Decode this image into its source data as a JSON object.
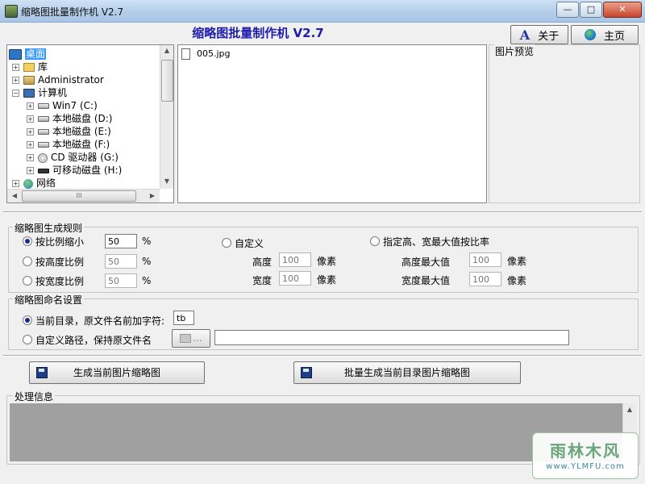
{
  "window": {
    "title": "缩略图批量制作机 V2.7",
    "min_glyph": "—",
    "max_glyph": "□",
    "close_glyph": "✕"
  },
  "header": {
    "heading": "缩略图批量制作机  V2.7",
    "about_label": "关于",
    "home_label": "主页"
  },
  "tree": {
    "items": [
      {
        "label": "桌面",
        "icon": "desktop-icon",
        "selected": true
      },
      {
        "label": "库",
        "icon": "library-icon"
      },
      {
        "label": "Administrator",
        "icon": "user-icon"
      },
      {
        "label": "计算机",
        "icon": "computer-icon"
      },
      {
        "label": "Win7 (C:)",
        "icon": "drive-icon"
      },
      {
        "label": "本地磁盘 (D:)",
        "icon": "drive-icon"
      },
      {
        "label": "本地磁盘 (E:)",
        "icon": "drive-icon"
      },
      {
        "label": "本地磁盘 (F:)",
        "icon": "drive-icon"
      },
      {
        "label": "CD 驱动器 (G:)",
        "icon": "cd-drive-icon"
      },
      {
        "label": "可移动磁盘 (H:)",
        "icon": "removable-drive-icon"
      },
      {
        "label": "网络",
        "icon": "network-icon"
      }
    ],
    "hscroll_grip": "III"
  },
  "files": {
    "items": [
      "005.jpg"
    ]
  },
  "preview": {
    "label": "图片预览"
  },
  "rules": {
    "group_label": "缩略图生成规则",
    "by_ratio_label": "按比例缩小",
    "by_ratio_value": "50",
    "by_height_label": "按高度比例",
    "by_height_value": "50",
    "by_width_label": "按宽度比例",
    "by_width_value": "50",
    "percent": "%",
    "custom_label": "自定义",
    "height_label": "高度",
    "height_value": "100",
    "width_label": "宽度",
    "width_value": "100",
    "pixel_unit": "像素",
    "maxdim_label": "指定高、宽最大值按比率",
    "max_height_label": "高度最大值",
    "max_height_value": "100",
    "max_width_label": "宽度最大值",
    "max_width_value": "100"
  },
  "naming": {
    "group_label": "缩略图命名设置",
    "current_dir_label": "当前目录，原文件名前加字符:",
    "prefix_value": "tb",
    "custom_path_label": "自定义路径，保持原文件名",
    "browse_label": "...",
    "path_value": ""
  },
  "actions": {
    "generate_current_label": "生成当前图片缩略图",
    "batch_generate_label": "批量生成当前目录图片缩略图"
  },
  "log": {
    "label": "处理信息"
  },
  "watermark": {
    "main": "雨林木风",
    "url": "www.YLMFU.com"
  },
  "colors": {
    "heading": "#1d1daa",
    "log_background": "#a0a0a0"
  }
}
